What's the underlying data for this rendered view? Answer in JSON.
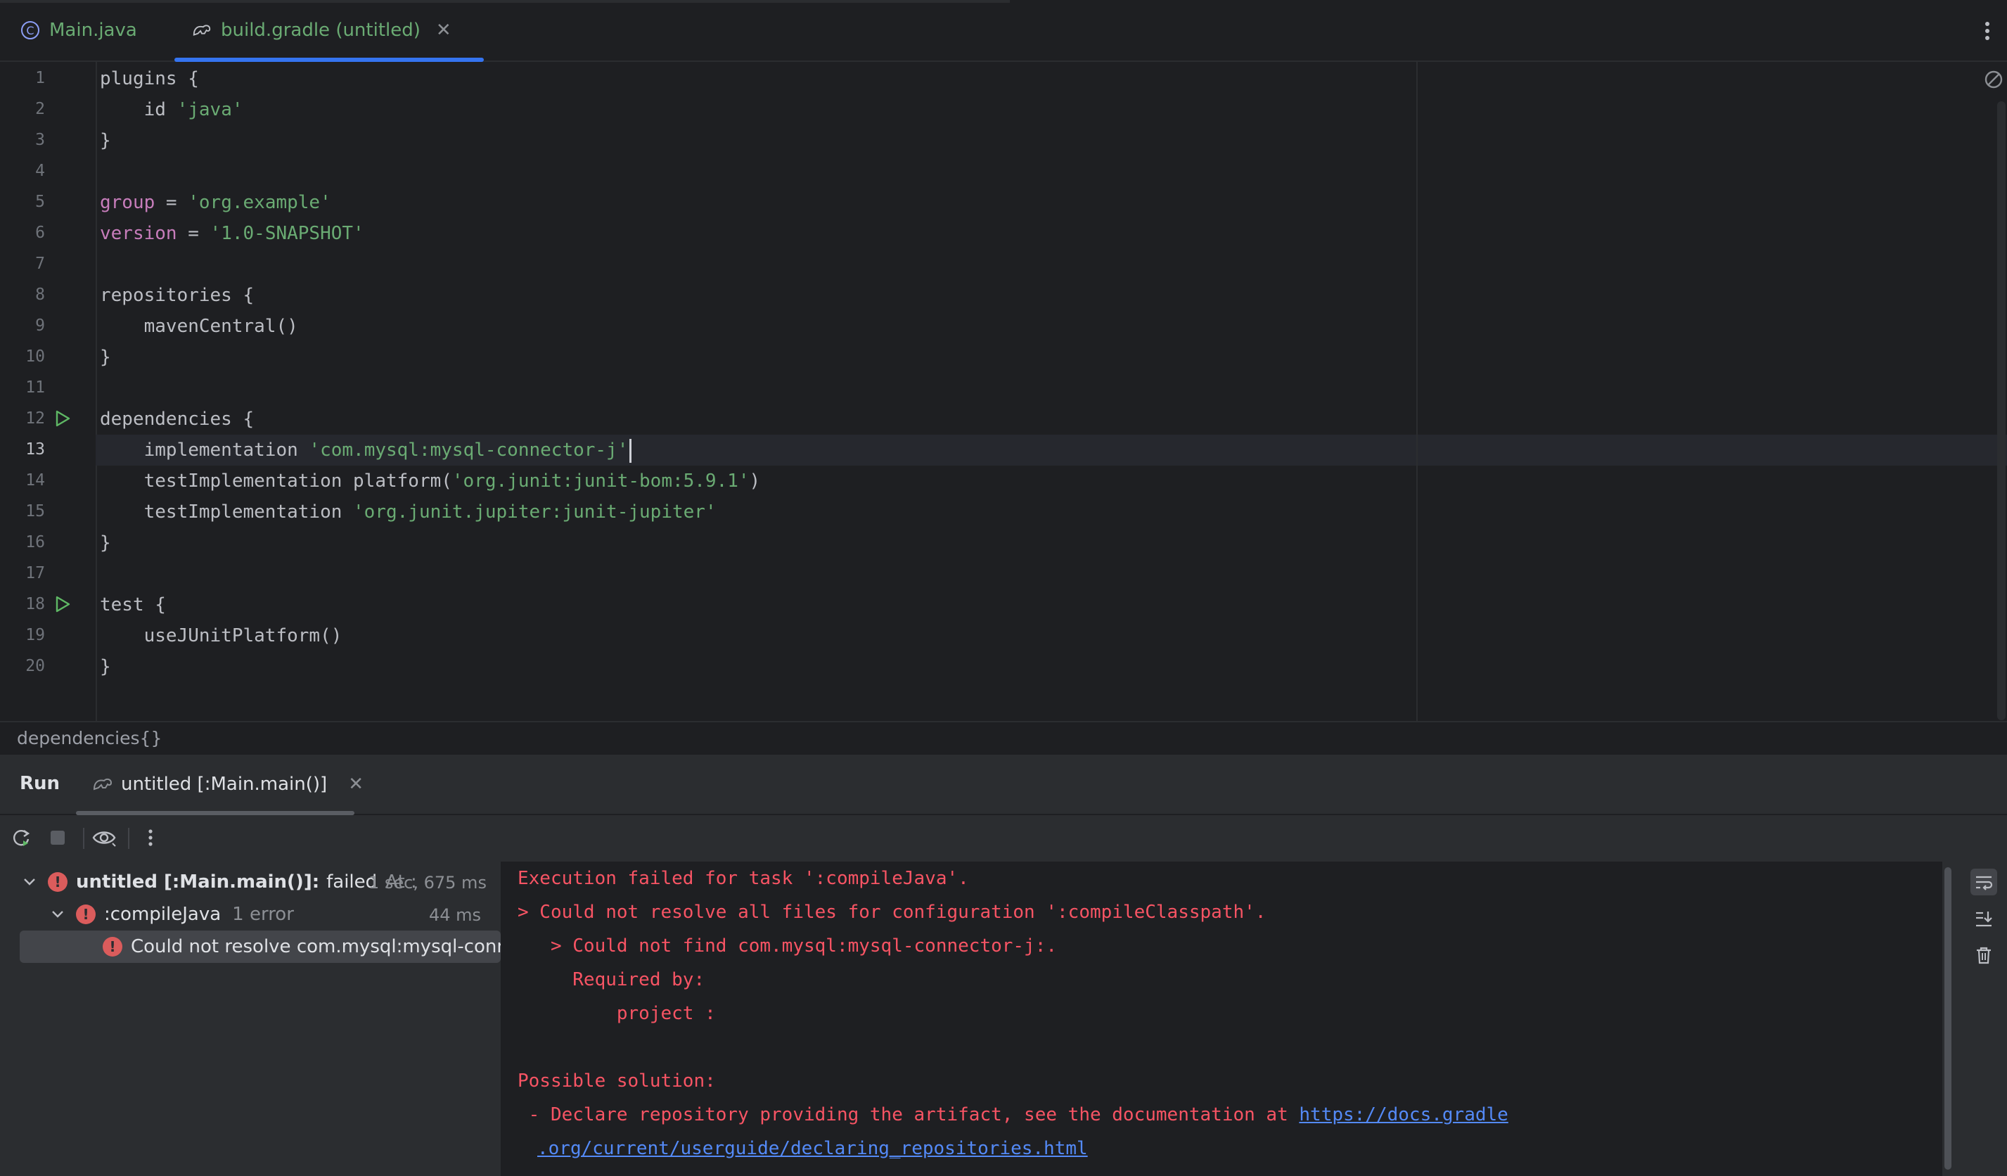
{
  "tabs": [
    {
      "label": "Main.java",
      "icon": "java-class-icon",
      "active": false
    },
    {
      "label": "build.gradle (untitled)",
      "icon": "gradle-elephant-icon",
      "active": true
    }
  ],
  "editor": {
    "current_line": 13,
    "lines": [
      {
        "n": "1",
        "text": "plugins {"
      },
      {
        "n": "2",
        "text": "    id 'java'"
      },
      {
        "n": "3",
        "text": "}"
      },
      {
        "n": "4",
        "text": ""
      },
      {
        "n": "5",
        "text": "group = 'org.example'"
      },
      {
        "n": "6",
        "text": "version = '1.0-SNAPSHOT'"
      },
      {
        "n": "7",
        "text": ""
      },
      {
        "n": "8",
        "text": "repositories {"
      },
      {
        "n": "9",
        "text": "    mavenCentral()"
      },
      {
        "n": "10",
        "text": "}"
      },
      {
        "n": "11",
        "text": ""
      },
      {
        "n": "12",
        "text": "dependencies {"
      },
      {
        "n": "13",
        "text": "    implementation 'com.mysql:mysql-connector-j'"
      },
      {
        "n": "14",
        "text": "    testImplementation platform('org.junit:junit-bom:5.9.1')"
      },
      {
        "n": "15",
        "text": "    testImplementation 'org.junit.jupiter:junit-jupiter'"
      },
      {
        "n": "16",
        "text": "}"
      },
      {
        "n": "17",
        "text": ""
      },
      {
        "n": "18",
        "text": "test {"
      },
      {
        "n": "19",
        "text": "    useJUnitPlatform()"
      },
      {
        "n": "20",
        "text": "}"
      }
    ]
  },
  "breadcrumb": "dependencies{}",
  "run": {
    "title": "Run",
    "tab_label": "untitled [:Main.main()]",
    "tree": {
      "root": {
        "label": "untitled [:Main.main()]:",
        "status": "failed",
        "at": "At :",
        "time": "1 sec, 675 ms"
      },
      "task": {
        "label": ":compileJava",
        "detail": "1 error",
        "time": "44 ms"
      },
      "error": {
        "label": "Could not resolve com.mysql:mysql-connector-j:."
      }
    },
    "console": [
      "Execution failed for task ':compileJava'.",
      "> Could not resolve all files for configuration ':compileClasspath'.",
      "   > Could not find com.mysql:mysql-connector-j:.",
      "     Required by:",
      "         project :",
      "",
      "Possible solution:",
      " - Declare repository providing the artifact, see the documentation at "
    ],
    "console_link_part1": "https://docs.gradle",
    "console_link_part2": ".org/current/userguide/declaring_repositories.html"
  },
  "colors": {
    "accent": "#3574f0",
    "error": "#f75464",
    "string": "#6aab73",
    "property": "#c77dbb",
    "link": "#548af7"
  }
}
